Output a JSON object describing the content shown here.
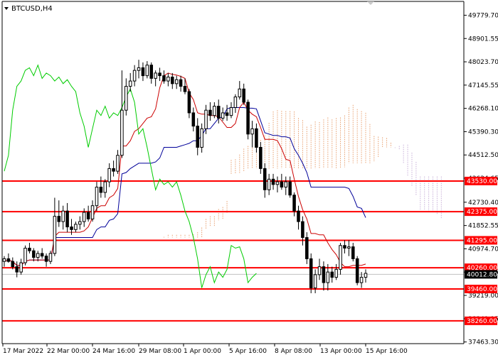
{
  "header": {
    "symbol_label": "BTCUSD,H4"
  },
  "colors": {
    "background": "#ffffff",
    "axis": "#000000",
    "candle": "#000000",
    "level": "#ff0000",
    "tenkan": "#cc0000",
    "kijun": "#000099",
    "chikou": "#00cc00",
    "cloud_a": "#e8a070",
    "cloud_b": "#c8b0d8",
    "price_line": "#c0c0c0"
  },
  "chart_data": {
    "type": "candlestick",
    "symbol": "BTCUSD",
    "timeframe": "H4",
    "y_range": [
      37400,
      50300
    ],
    "y_ticks": [
      "49779.70",
      "48901.55",
      "48023.70",
      "47145.55",
      "46268.10",
      "45390.30",
      "44512.50",
      "43634.65",
      "42730.40",
      "41852.55",
      "40974.70",
      "40096.85",
      "39219.00",
      "38341.15",
      "37463.30"
    ],
    "x_ticks": [
      "17 Mar 2022",
      "22 Mar 00:00",
      "24 Mar 16:00",
      "29 Mar 08:00",
      "1 Apr 00:00",
      "5 Apr 16:00",
      "8 Apr 08:00",
      "13 Apr 00:00",
      "15 Apr 16:00"
    ],
    "levels": [
      "43530.00",
      "42375.00",
      "41295.00",
      "40260.00",
      "39460.00",
      "38260.00"
    ],
    "current_price": "40012.80",
    "candles": [
      [
        40500,
        40700,
        40300,
        40600
      ],
      [
        40600,
        40800,
        40450,
        40500
      ],
      [
        40500,
        40650,
        40200,
        40300
      ],
      [
        40300,
        40500,
        39900,
        40100
      ],
      [
        40100,
        40600,
        40000,
        40450
      ],
      [
        40450,
        41100,
        40350,
        41000
      ],
      [
        41000,
        41200,
        40800,
        40900
      ],
      [
        40900,
        41000,
        40500,
        40650
      ],
      [
        40650,
        40900,
        40500,
        40800
      ],
      [
        40800,
        41000,
        40600,
        40700
      ],
      [
        40700,
        40800,
        40300,
        40500
      ],
      [
        40500,
        40900,
        40400,
        40800
      ],
      [
        40800,
        42900,
        40700,
        42200
      ],
      [
        42200,
        42800,
        41800,
        42000
      ],
      [
        42000,
        42600,
        41700,
        42400
      ],
      [
        42400,
        42700,
        41600,
        41800
      ],
      [
        41800,
        42100,
        41500,
        41700
      ],
      [
        41700,
        42000,
        41600,
        41900
      ],
      [
        41900,
        42200,
        41700,
        42000
      ],
      [
        42000,
        42500,
        41800,
        42350
      ],
      [
        42350,
        42600,
        42000,
        42100
      ],
      [
        42100,
        42800,
        42000,
        42600
      ],
      [
        42600,
        43500,
        42400,
        43300
      ],
      [
        43300,
        43700,
        42900,
        43100
      ],
      [
        43100,
        43600,
        42900,
        43500
      ],
      [
        43500,
        44200,
        43300,
        44000
      ],
      [
        44000,
        44300,
        43700,
        43900
      ],
      [
        43900,
        44700,
        43800,
        44500
      ],
      [
        44500,
        47700,
        44400,
        46200
      ],
      [
        46200,
        47400,
        46000,
        47100
      ],
      [
        47100,
        47600,
        46900,
        47300
      ],
      [
        47300,
        47900,
        47100,
        47700
      ],
      [
        47700,
        48100,
        47400,
        47800
      ],
      [
        47800,
        48000,
        47300,
        47500
      ],
      [
        47500,
        48050,
        47400,
        47900
      ],
      [
        47900,
        48000,
        47200,
        47400
      ],
      [
        47400,
        47700,
        47100,
        47600
      ],
      [
        47600,
        47800,
        47300,
        47500
      ],
      [
        47500,
        47700,
        47200,
        47300
      ],
      [
        47300,
        47600,
        47100,
        47450
      ],
      [
        47450,
        47600,
        47000,
        47200
      ],
      [
        47200,
        47500,
        47000,
        47350
      ],
      [
        47350,
        47500,
        46900,
        47100
      ],
      [
        47100,
        47400,
        46800,
        46900
      ],
      [
        46900,
        47000,
        45900,
        46100
      ],
      [
        46100,
        46300,
        45400,
        45600
      ],
      [
        45600,
        45900,
        44500,
        44800
      ],
      [
        44800,
        45700,
        44600,
        45500
      ],
      [
        45500,
        46400,
        45300,
        46200
      ],
      [
        46200,
        46500,
        45800,
        46000
      ],
      [
        46000,
        46500,
        45900,
        46350
      ],
      [
        46350,
        46600,
        45700,
        45900
      ],
      [
        45900,
        46300,
        45800,
        46100
      ],
      [
        46100,
        46400,
        45800,
        46000
      ],
      [
        46000,
        46500,
        45900,
        46300
      ],
      [
        46300,
        46800,
        46100,
        46700
      ],
      [
        46700,
        47300,
        46600,
        47000
      ],
      [
        47000,
        47200,
        46400,
        46500
      ],
      [
        46500,
        46600,
        45100,
        45300
      ],
      [
        45300,
        45800,
        44800,
        45500
      ],
      [
        45500,
        45700,
        44600,
        44800
      ],
      [
        44800,
        45000,
        43800,
        44000
      ],
      [
        44000,
        44200,
        42900,
        43200
      ],
      [
        43200,
        43800,
        43000,
        43600
      ],
      [
        43600,
        43800,
        43200,
        43400
      ],
      [
        43400,
        43700,
        43100,
        43500
      ],
      [
        43500,
        43800,
        43200,
        43300
      ],
      [
        43300,
        43700,
        43000,
        43500
      ],
      [
        43500,
        43700,
        42900,
        43000
      ],
      [
        43000,
        43100,
        42200,
        42400
      ],
      [
        42400,
        42600,
        41700,
        42000
      ],
      [
        42000,
        42200,
        41100,
        41400
      ],
      [
        41400,
        41600,
        40400,
        40600
      ],
      [
        40600,
        40800,
        39300,
        39500
      ],
      [
        39500,
        40200,
        39300,
        40000
      ],
      [
        40000,
        40600,
        39800,
        40300
      ],
      [
        40300,
        40500,
        39400,
        39700
      ],
      [
        39700,
        40400,
        39400,
        40100
      ],
      [
        40100,
        40300,
        39700,
        39900
      ],
      [
        39900,
        40400,
        39800,
        40200
      ],
      [
        40200,
        41200,
        40000,
        41100
      ],
      [
        41100,
        41300,
        40800,
        41000
      ],
      [
        41000,
        41300,
        40700,
        41050
      ],
      [
        41050,
        41200,
        40500,
        40600
      ],
      [
        40600,
        40700,
        39600,
        39700
      ],
      [
        39700,
        40100,
        39500,
        39900
      ],
      [
        39900,
        40200,
        39700,
        40050
      ]
    ]
  }
}
